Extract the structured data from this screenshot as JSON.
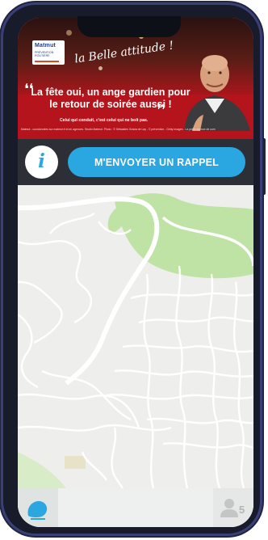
{
  "ad": {
    "brand": "Matmut",
    "brand_sub": "PRÉVENTION ROUTIÈRE",
    "script_slogan": "la Belle attitude !",
    "quote": "La fête oui, un ange gardien pour le retour de soirée aussi !",
    "tagline": "Celui qui conduit, c'est celui qui ne boit pas.",
    "legal": "Matmut - coordonnées sur matmut.fr et en agences. Studio Matmut. Photo : © Sébastien Gracia de Lay - © prévention - Getty Images - La petite agence de com"
  },
  "actions": {
    "info_icon": "i",
    "reminder_label": "M'ENVOYER UN RAPPEL"
  },
  "colors": {
    "accent": "#2aa6e0",
    "bar": "#2c3036",
    "ad_red": "#b5141c",
    "map_bg": "#eeeeec",
    "map_green": "#bfe3a5",
    "map_road": "#ffffff"
  },
  "bottom": {
    "left_icon": "user-silhouette-icon",
    "right_icon": "contacts-icon",
    "contacts_count": "5"
  }
}
